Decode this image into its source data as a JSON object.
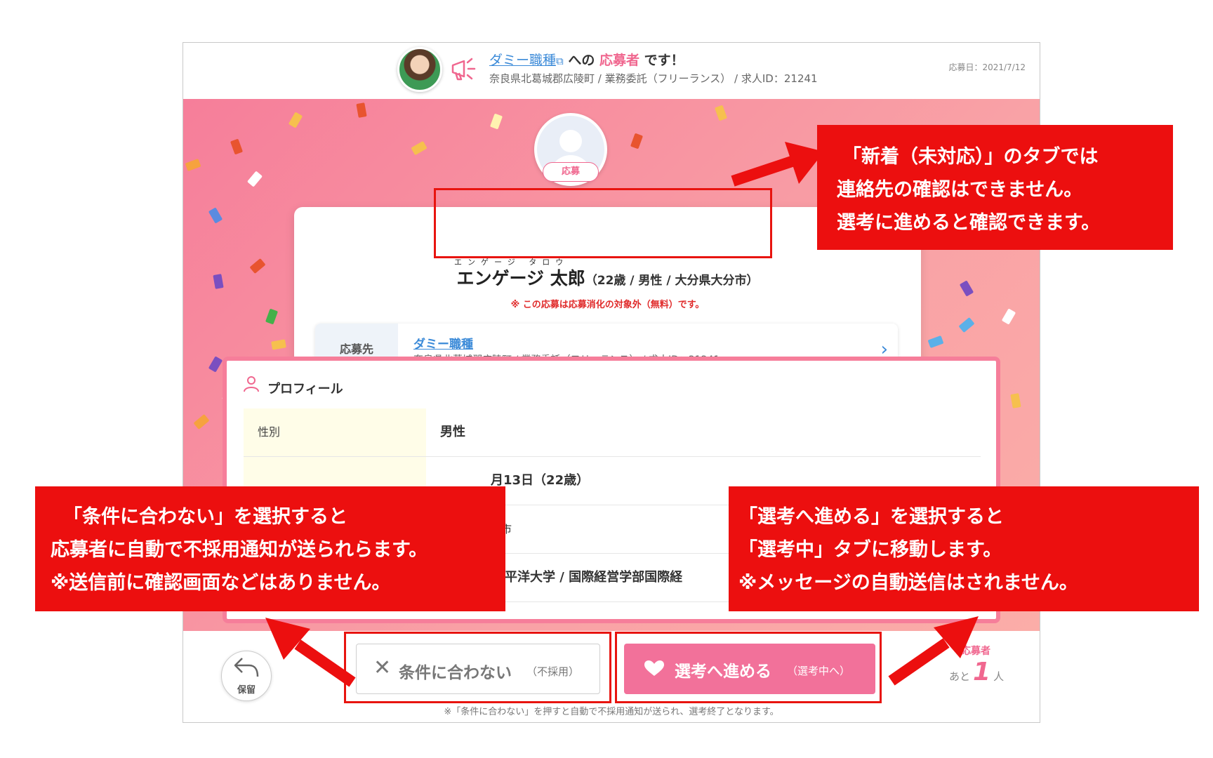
{
  "header": {
    "job_link": "ダミー職種",
    "title_mid": "への",
    "title_highlight": "応募者",
    "title_end": "です！",
    "subtitle": "奈良県北葛城郡広陵町 / 業務委託（フリーランス） / 求人ID：21241",
    "applied_date": "応募日：2021/7/12"
  },
  "candidate": {
    "badge": "応募",
    "furigana": "エンゲージ タロウ",
    "name": "エンゲージ 太郎",
    "meta": "（22歳 / 男性 / 大分県大分市）",
    "notice": "※ この応募は応募消化の対象外（無料）です。"
  },
  "destination": {
    "label": "応募先",
    "job": "ダミー職種",
    "detail": "奈良県北葛城郡広陵町 / 業務委託（フリーランス） / 求人ID：21241"
  },
  "profile": {
    "title": "プロフィール",
    "rows": [
      {
        "key": "性別",
        "value": "男性"
      },
      {
        "key": "",
        "value": "月13日（22歳）"
      },
      {
        "key": "",
        "value": "分市"
      },
      {
        "key": "",
        "value": "ジア太平洋大学 / 国際経営学部国際経"
      }
    ]
  },
  "actions": {
    "hold_label": "保留",
    "reject_label": "条件に合わない",
    "reject_sub": "（不採用）",
    "advance_label": "選考へ進める",
    "advance_sub": "（選考中へ）",
    "remaining_label": "応募者",
    "remaining_prefix": "あと",
    "remaining_count": "1",
    "remaining_suffix": "人",
    "footnote": "※「条件に合わない」を押すと自動で不採用通知が送られ、選考終了となります。"
  },
  "annotations": {
    "top_right": [
      "「新着（未対応）」のタブでは",
      "連絡先の確認はできません。",
      "選考に進めると確認できます。"
    ],
    "bottom_left": [
      "「条件に合わない」を選択すると",
      "応募者に自動で不採用通知が送られらます。",
      "※送信前に確認画面などはありません。"
    ],
    "bottom_right": [
      "「選考へ進める」を選択すると",
      "「選考中」タブに移動します。",
      "※メッセージの自動送信はされません。"
    ]
  },
  "colors": {
    "accent_pink": "#f0678f",
    "link_blue": "#3b8ad8",
    "annotation_red": "#ec0f0f"
  }
}
